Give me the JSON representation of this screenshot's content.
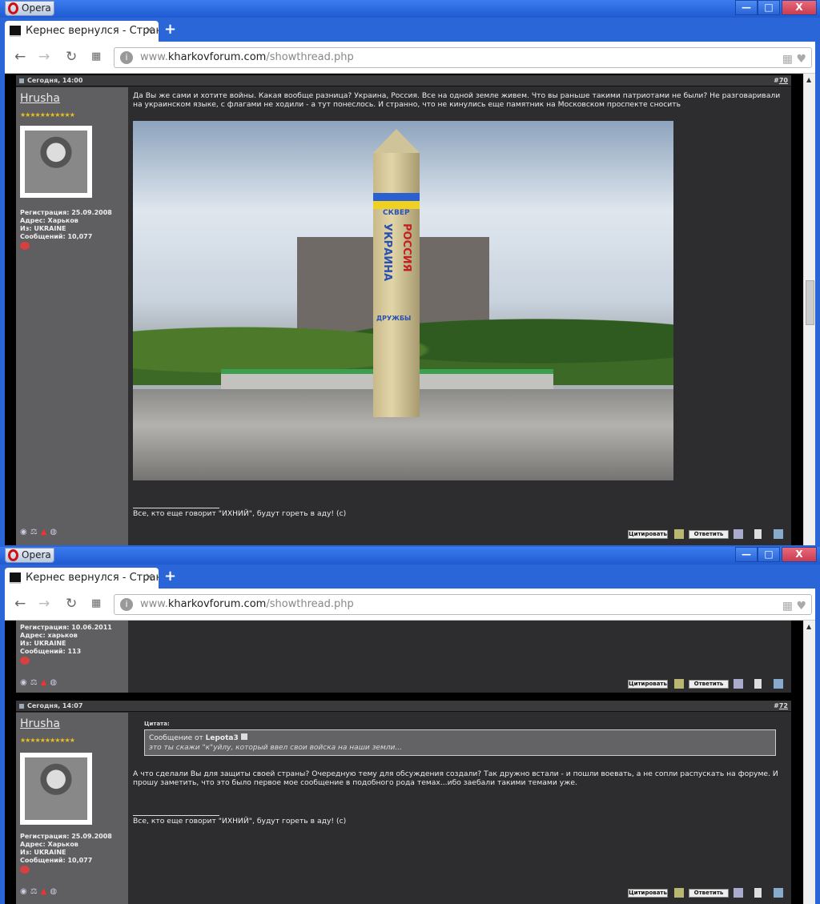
{
  "browser": {
    "app_name": "Opera",
    "tab_title": "Кернес вернулся - Страница",
    "url_prefix": "www.",
    "url_domain": "kharkovforum.com",
    "url_path": "/showthread.php",
    "minimize": "—",
    "maximize": "□",
    "close": "X"
  },
  "window1": {
    "post": {
      "date": "Сегодня, 14:00",
      "number": "70",
      "username": "Hrusha",
      "stars": "★★★★★★★★★★★",
      "info": {
        "registration": "Регистрация: 25.09.2008",
        "address": "Адрес: Харьков",
        "from": "Из: UKRAINE",
        "messages": "Сообщений: 10,077"
      },
      "text": "Да Вы же сами и хотите войны. Какая вообще разница? Украина, Россия. Все на одной земле живем. Что вы раньше такими патриотами не были? Не разговаривали на украинском языке, с флагами не ходили - а тут понеслось. И странно, что не кинулись еще памятник на Московском проспекте сносить",
      "photo_text": {
        "top": "СКВЕР",
        "left": "УКРАИНА",
        "right": "РОССИЯ",
        "bottom": "ДРУЖБЫ"
      },
      "signature": "Все, кто еще говорит \"ИХНИЙ\", будут гореть в аду! (с)",
      "quote_button": "Цитировать",
      "reply_button": "Ответить"
    }
  },
  "window2": {
    "prev_post": {
      "info": {
        "registration": "Регистрация: 10.06.2011",
        "address": "Адрес: харьков",
        "from": "Из: UKRAINE",
        "messages": "Сообщений: 113"
      },
      "quote_button": "Цитировать",
      "reply_button": "Ответить"
    },
    "post": {
      "date": "Сегодня, 14:07",
      "number": "72",
      "username": "Hrusha",
      "stars": "★★★★★★★★★★★",
      "info": {
        "registration": "Регистрация: 25.09.2008",
        "address": "Адрес: Харьков",
        "from": "Из: UKRAINE",
        "messages": "Сообщений: 10,077"
      },
      "quote_label": "Цитата:",
      "quote_prefix": "Сообщение от ",
      "quote_author": "Lepota3",
      "quote_text": "это ты скажи \"к\"уйлу, который ввел свои войска на наши земли...",
      "text": "А что сделали Вы для защиты своей страны? Очередную тему для обсуждения создали? Так дружно встали - и пошли воевать, а не сопли распускать на форуме. И прошу заметить, что это было первое мое сообщение в подобного рода темах...ибо заебали такими темами уже.",
      "signature": "Все, кто еще говорит \"ИХНИЙ\", будут гореть в аду! (с)",
      "quote_button": "Цитировать",
      "reply_button": "Ответить"
    }
  }
}
